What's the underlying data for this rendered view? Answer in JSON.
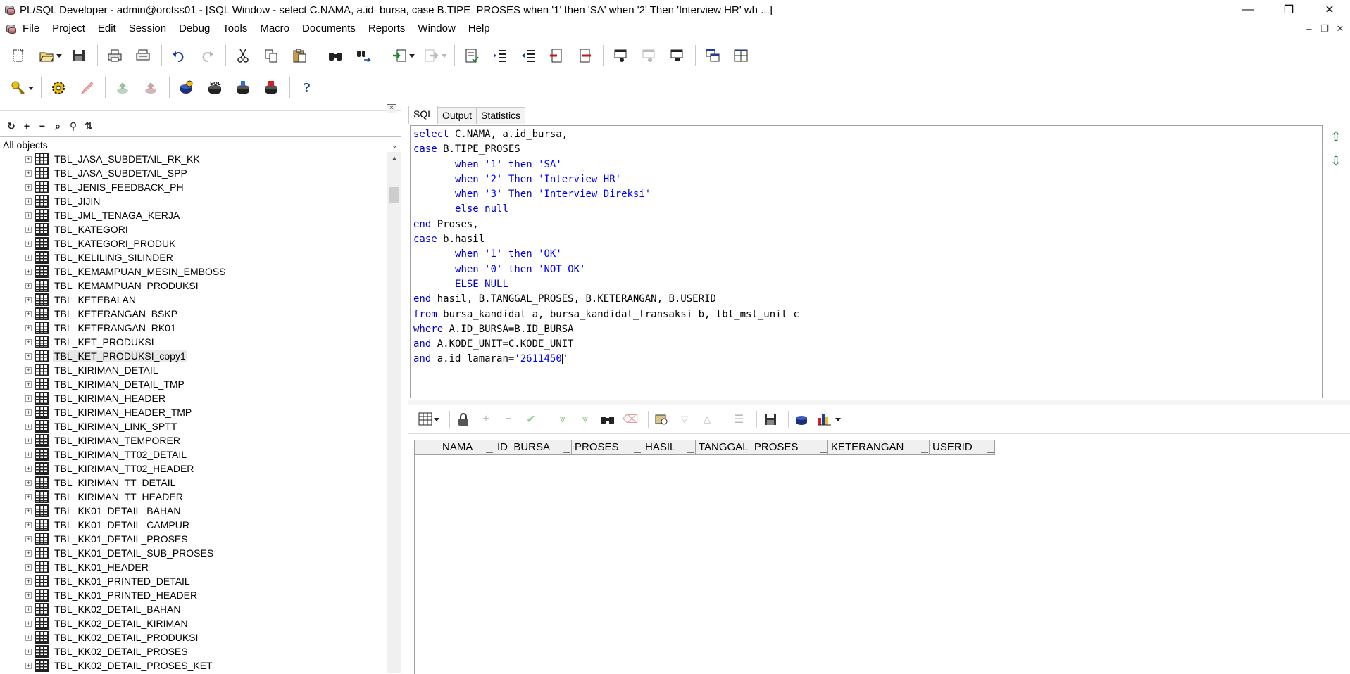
{
  "title_bar": {
    "title": "PL/SQL Developer - admin@orctss01 - [SQL Window - select C.NAMA, a.id_bursa, case B.TIPE_PROSES when '1' then 'SA' when '2' Then 'Interview HR' wh ...]",
    "minimize": "—",
    "maximize": "❐",
    "close": "✕"
  },
  "menu": {
    "items": [
      "File",
      "Project",
      "Edit",
      "Session",
      "Debug",
      "Tools",
      "Macro",
      "Documents",
      "Reports",
      "Window",
      "Help"
    ],
    "mdi_min": "–",
    "mdi_restore": "❐",
    "mdi_close": "✕"
  },
  "toolbar1": {
    "icons": [
      "new-icon",
      "open-icon",
      "save-icon",
      "print-icon",
      "print-preview-icon",
      "undo-icon",
      "redo-icon",
      "cut-icon",
      "copy-icon",
      "paste-icon",
      "find-icon",
      "replace-icon",
      "import-icon",
      "export-icon",
      "template-icon",
      "indent-icon",
      "unindent-icon",
      "uppercase-icon",
      "lowercase-icon",
      "compile-icon",
      "window-list-icon"
    ]
  },
  "toolbar2": {
    "icons": [
      "key-icon",
      "execute-icon",
      "break-icon",
      "commit-icon",
      "rollback-icon",
      "session-icon",
      "sql-icon",
      "connect-icon",
      "disconnect-icon",
      "help-icon"
    ],
    "help_label": "?"
  },
  "object_browser": {
    "filter_label": "All objects",
    "close_label": "×",
    "tool_icons": [
      "refresh-icon",
      "add-icon",
      "remove-icon",
      "find-icon",
      "filter-icon",
      "sort-icon"
    ],
    "items": [
      "TBL_JASA_SUBDETAIL_RK_KK",
      "TBL_JASA_SUBDETAIL_SPP",
      "TBL_JENIS_FEEDBACK_PH",
      "TBL_JIJIN",
      "TBL_JML_TENAGA_KERJA",
      "TBL_KATEGORI",
      "TBL_KATEGORI_PRODUK",
      "TBL_KELILING_SILINDER",
      "TBL_KEMAMPUAN_MESIN_EMBOSS",
      "TBL_KEMAMPUAN_PRODUKSI",
      "TBL_KETEBALAN",
      "TBL_KETERANGAN_BSKP",
      "TBL_KETERANGAN_RK01",
      "TBL_KET_PRODUKSI",
      "TBL_KET_PRODUKSI_copy1",
      "TBL_KIRIMAN_DETAIL",
      "TBL_KIRIMAN_DETAIL_TMP",
      "TBL_KIRIMAN_HEADER",
      "TBL_KIRIMAN_HEADER_TMP",
      "TBL_KIRIMAN_LINK_SPTT",
      "TBL_KIRIMAN_TEMPORER",
      "TBL_KIRIMAN_TT02_DETAIL",
      "TBL_KIRIMAN_TT02_HEADER",
      "TBL_KIRIMAN_TT_DETAIL",
      "TBL_KIRIMAN_TT_HEADER",
      "TBL_KK01_DETAIL_BAHAN",
      "TBL_KK01_DETAIL_CAMPUR",
      "TBL_KK01_DETAIL_PROSES",
      "TBL_KK01_DETAIL_SUB_PROSES",
      "TBL_KK01_HEADER",
      "TBL_KK01_PRINTED_DETAIL",
      "TBL_KK01_PRINTED_HEADER",
      "TBL_KK02_DETAIL_BAHAN",
      "TBL_KK02_DETAIL_KIRIMAN",
      "TBL_KK02_DETAIL_PRODUKSI",
      "TBL_KK02_DETAIL_PROSES",
      "TBL_KK02_DETAIL_PROSES_KET"
    ],
    "selected": "TBL_KET_PRODUKSI_copy1"
  },
  "sql_window": {
    "tabs": [
      "SQL",
      "Output",
      "Statistics"
    ],
    "active_tab": "SQL",
    "code_lines": [
      "select C.NAMA, a.id_bursa,",
      "case B.TIPE_PROSES",
      "       when '1' then 'SA'",
      "       when '2' Then 'Interview HR'",
      "       when '3' Then 'Interview Direksi'",
      "       else null",
      "end Proses,",
      "case b.hasil",
      "       when '1' then 'OK'",
      "       when '0' then 'NOT OK'",
      "       ELSE NULL",
      "end hasil, B.TANGGAL_PROSES, B.KETERANGAN, B.USERID",
      "from bursa_kandidat a, bursa_kandidat_transaksi b, tbl_mst_unit c",
      "where A.ID_BURSA=B.ID_BURSA",
      "and A.KODE_UNIT=C.KODE_UNIT",
      "and a.id_lamaran='2611450'"
    ],
    "nav_up": "⇧",
    "nav_down": "⇩"
  },
  "result_grid": {
    "toolbar_icons": [
      "grid-select-icon",
      "lock-icon",
      "add-record-icon",
      "delete-record-icon",
      "post-icon",
      "fetch-next-icon",
      "fetch-last-icon",
      "find-icon",
      "clear-icon",
      "query-by-example-icon",
      "filter-down-icon",
      "filter-up-icon",
      "single-record-icon",
      "save-icon",
      "export-icon",
      "chart-icon"
    ],
    "columns": [
      "",
      "NAMA",
      "ID_BURSA",
      "PROSES",
      "HASIL",
      "TANGGAL_PROSES",
      "KETERANGAN",
      "USERID"
    ]
  }
}
